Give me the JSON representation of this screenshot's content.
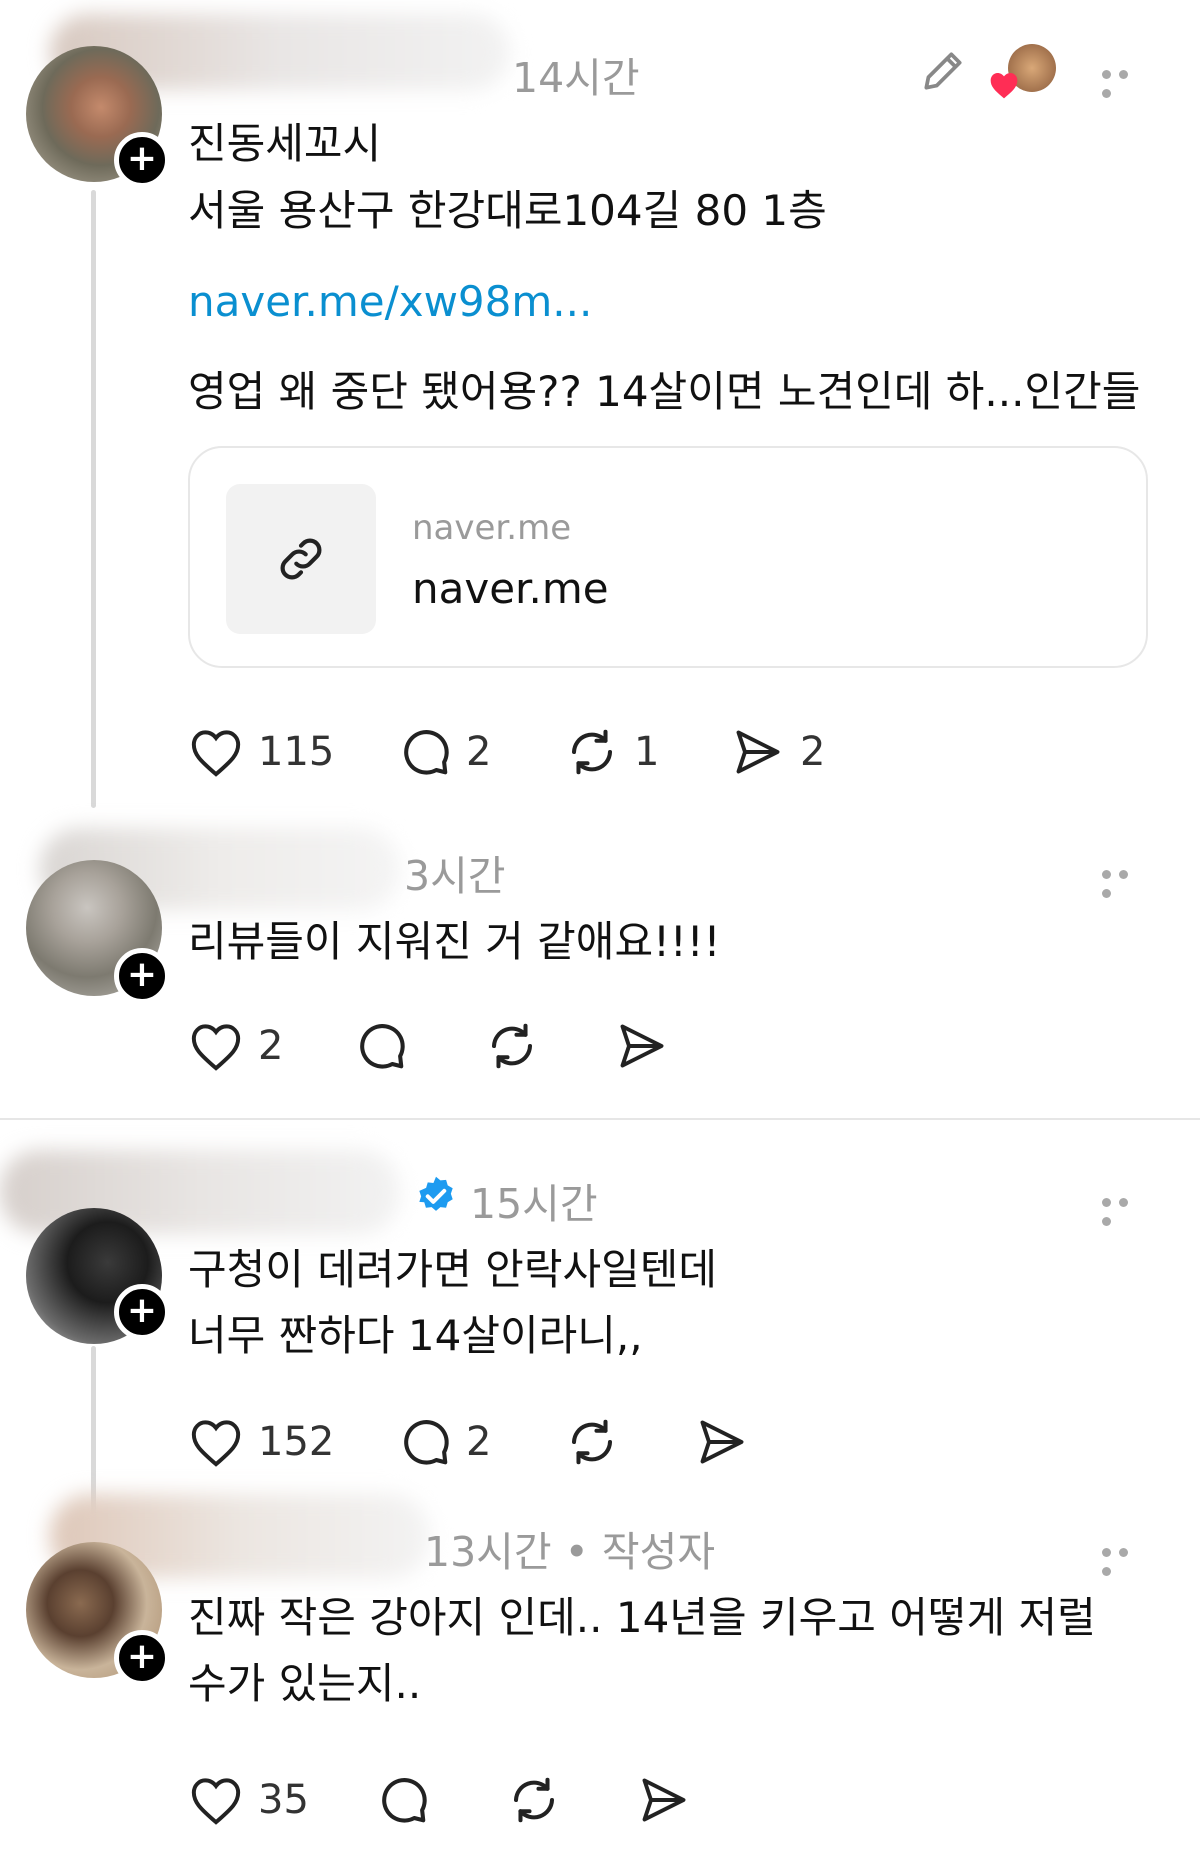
{
  "posts": [
    {
      "time": "14시간",
      "lines": [
        "진동세꼬시",
        "서울 용산구 한강대로104길 80 1층"
      ],
      "link": "naver.me/xw98m...",
      "extra": "영업 왜 중단 됐어용?? 14살이면 노견인데 하...인간들",
      "card": {
        "domain": "naver.me",
        "title": "naver.me"
      },
      "likes": "115",
      "replies": "2",
      "reposts": "1",
      "shares": "2"
    },
    {
      "time": "3시간",
      "lines": [
        "리뷰들이 지워진 거 같애요!!!!"
      ],
      "likes": "2"
    },
    {
      "time": "15시간",
      "lines": [
        "구청이 데려가면 안락사일텐데",
        "너무 짠하다 14살이라니,,"
      ],
      "likes": "152",
      "replies": "2"
    },
    {
      "time": "13시간",
      "author_tag": "• 작성자",
      "lines": [
        "진짜 작은 강아지 인데.. 14년을 키우고 어떻게 저럴",
        "수가 있는지.."
      ],
      "likes": "35"
    }
  ],
  "icons": {
    "more": "more-dots-icon",
    "edit": "pencil-icon",
    "like": "heart-icon",
    "reply": "comment-icon",
    "repost": "repost-icon",
    "share": "send-icon",
    "follow": "plus-icon",
    "verified": "verified-badge-icon",
    "link": "link-icon"
  },
  "colors": {
    "link": "#0a8fd0",
    "verified": "#1d9bf0",
    "heart": "#ff2d55"
  }
}
